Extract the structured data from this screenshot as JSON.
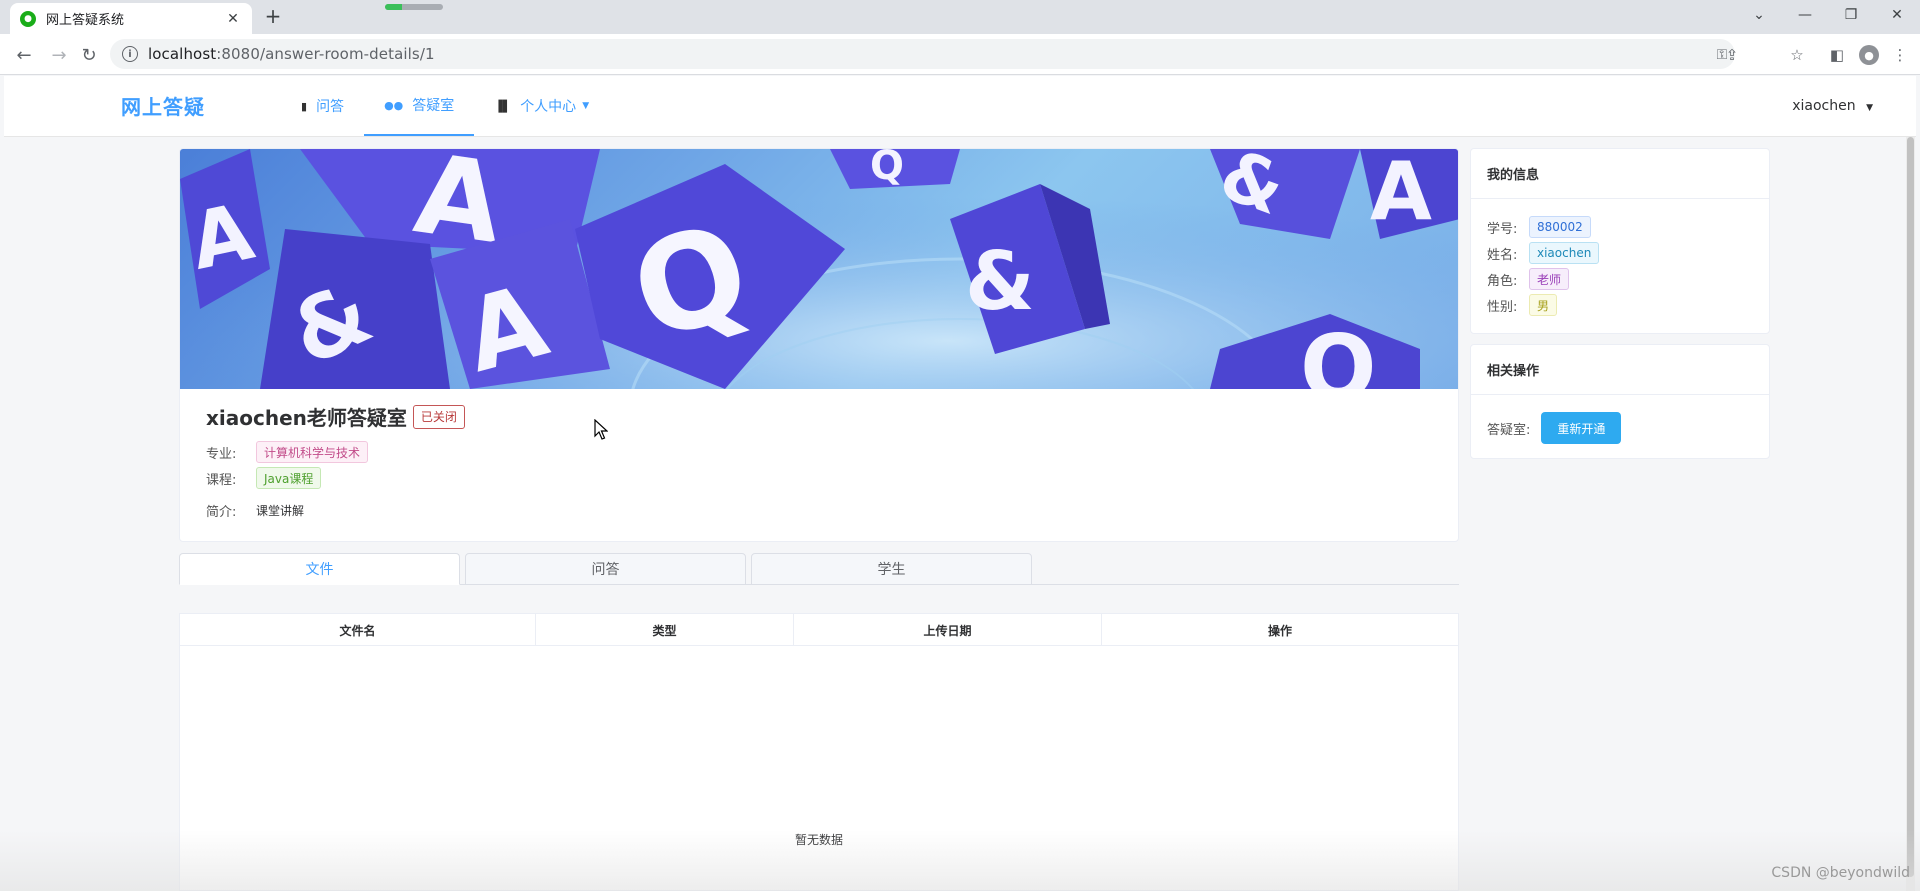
{
  "browser": {
    "tab_title": "网上答疑系统",
    "url_host": "localhost",
    "url_path": ":8080/answer-room-details/1",
    "loading_progress": 0.3
  },
  "header": {
    "brand": "网上答疑",
    "nav": [
      {
        "label": "问答",
        "icon": "book-icon"
      },
      {
        "label": "答疑室",
        "icon": "group-icon"
      },
      {
        "label": "个人中心",
        "icon": "bar-chart-icon"
      }
    ],
    "user_name": "xiaochen"
  },
  "room": {
    "title": "xiaochen老师答疑室",
    "status": "已关闭",
    "major_label": "专业:",
    "major": "计算机科学与技术",
    "course_label": "课程:",
    "course": "Java课程",
    "intro_label": "简介:",
    "intro": "课堂讲解"
  },
  "tabs": [
    "文件",
    "问答",
    "学生"
  ],
  "table": {
    "columns": [
      "文件名",
      "类型",
      "上传日期",
      "操作"
    ],
    "empty_text": "暂无数据"
  },
  "my_info": {
    "title": "我的信息",
    "student_id_label": "学号:",
    "student_id": "880002",
    "name_label": "姓名:",
    "name": "xiaochen",
    "role_label": "角色:",
    "role": "老师",
    "gender_label": "性别:",
    "gender": "男"
  },
  "actions": {
    "title": "相关操作",
    "room_label": "答疑室:",
    "reopen_button": "重新开通"
  },
  "watermark": "CSDN @beyondwild",
  "colors": {
    "accent": "#409eff",
    "button": "#2eaaf0",
    "closed_tag": "#c45656"
  }
}
